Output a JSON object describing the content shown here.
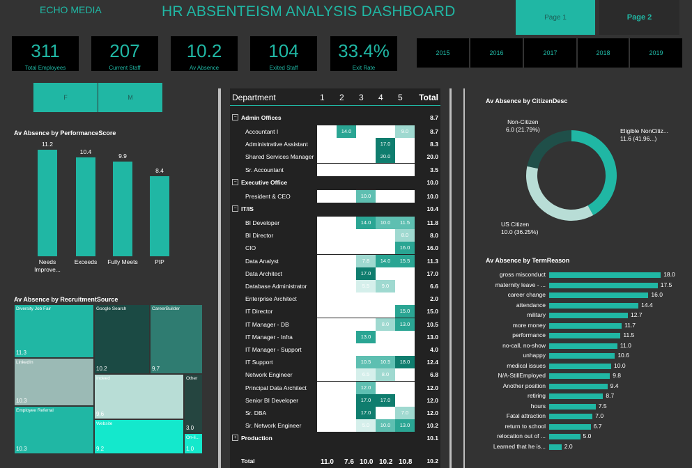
{
  "header": {
    "brand": "ECHO MEDIA",
    "title": "HR ABSENTEISM ANALYSIS DASHBOARD",
    "pages": [
      "Page 1",
      "Page 2"
    ]
  },
  "kpis": [
    {
      "value": "311",
      "label": "Total Employees"
    },
    {
      "value": "207",
      "label": "Current Staff"
    },
    {
      "value": "10.2",
      "label": "Av Absence"
    },
    {
      "value": "104",
      "label": "Exited Staff"
    },
    {
      "value": "33.4%",
      "label": "Exit Rate"
    }
  ],
  "years": [
    "2015",
    "2016",
    "2017",
    "2018",
    "2019"
  ],
  "genders": [
    "F",
    "M"
  ],
  "perf_chart": {
    "title": "Av Absence by PerformanceScore",
    "chart_data": {
      "type": "bar",
      "categories": [
        "Needs Improve...",
        "Exceeds",
        "Fully Meets",
        "PIP"
      ],
      "values": [
        11.2,
        10.4,
        9.9,
        8.4
      ]
    }
  },
  "recruit_chart": {
    "title": "Av Absence by RecruitmentSource",
    "chart_data": {
      "type": "treemap",
      "items": [
        {
          "label": "Diversity Job Fair",
          "value": 11.3
        },
        {
          "label": "LinkedIn",
          "value": 10.3
        },
        {
          "label": "Employee Referral",
          "value": 10.3
        },
        {
          "label": "Google Search",
          "value": 10.2
        },
        {
          "label": "CareerBuilder",
          "value": 9.7
        },
        {
          "label": "Indeed",
          "value": 9.6
        },
        {
          "label": "Website",
          "value": 9.2
        },
        {
          "label": "Other",
          "value": 3.0
        },
        {
          "label": "On-li...",
          "value": 1.0
        }
      ]
    }
  },
  "matrix": {
    "header": {
      "dept": "Department",
      "cols": [
        "1",
        "2",
        "3",
        "4",
        "5"
      ],
      "total": "Total"
    },
    "rows": [
      {
        "type": "group",
        "name": "Admin Offices",
        "total": "8.7",
        "sym": "⊟"
      },
      {
        "type": "item",
        "name": "Accountant I",
        "cells": [
          "",
          "14.0",
          "",
          "",
          "9.0"
        ],
        "total": "8.7"
      },
      {
        "type": "item",
        "name": "Administrative Assistant",
        "cells": [
          "",
          "",
          "",
          "17.0",
          ""
        ],
        "total": "8.3"
      },
      {
        "type": "item",
        "name": "Shared Services Manager",
        "cells": [
          "",
          "",
          "",
          "20.0",
          ""
        ],
        "total": "20.0"
      },
      {
        "type": "item",
        "name": "Sr. Accountant",
        "cells": [
          "",
          "",
          "",
          "",
          ""
        ],
        "total": "3.5"
      },
      {
        "type": "group",
        "name": "Executive Office",
        "total": "10.0",
        "sym": "⊟"
      },
      {
        "type": "item",
        "name": "President & CEO",
        "cells": [
          "",
          "",
          "10.0",
          "",
          ""
        ],
        "total": "10.0"
      },
      {
        "type": "group",
        "name": "IT/IS",
        "total": "10.4",
        "sym": "⊟"
      },
      {
        "type": "item",
        "name": "BI Developer",
        "cells": [
          "",
          "",
          "14.0",
          "10.0",
          "11.5"
        ],
        "total": "11.8"
      },
      {
        "type": "item",
        "name": "BI Director",
        "cells": [
          "",
          "",
          "",
          "",
          "8.0"
        ],
        "total": "8.0"
      },
      {
        "type": "item",
        "name": "CIO",
        "cells": [
          "",
          "",
          "",
          "",
          "16.0"
        ],
        "total": "16.0"
      },
      {
        "type": "item",
        "name": "Data Analyst",
        "cells": [
          "",
          "",
          "7.8",
          "14.0",
          "15.5"
        ],
        "total": "11.3"
      },
      {
        "type": "item",
        "name": "Data Architect",
        "cells": [
          "",
          "",
          "17.0",
          "",
          ""
        ],
        "total": "17.0"
      },
      {
        "type": "item",
        "name": "Database Administrator",
        "cells": [
          "",
          "",
          "5.5",
          "9.0",
          ""
        ],
        "total": "6.6"
      },
      {
        "type": "item",
        "name": "Enterprise Architect",
        "cells": [
          "",
          "",
          "",
          "",
          ""
        ],
        "total": "2.0"
      },
      {
        "type": "item",
        "name": "IT Director",
        "cells": [
          "",
          "",
          "",
          "",
          "15.0"
        ],
        "total": "15.0"
      },
      {
        "type": "item",
        "name": "IT Manager - DB",
        "cells": [
          "",
          "",
          "",
          "8.0",
          "13.0"
        ],
        "total": "10.5"
      },
      {
        "type": "item",
        "name": "IT Manager - Infra",
        "cells": [
          "",
          "",
          "13.0",
          "",
          ""
        ],
        "total": "13.0"
      },
      {
        "type": "item",
        "name": "IT Manager - Support",
        "cells": [
          "",
          "",
          "",
          "",
          ""
        ],
        "total": "4.0"
      },
      {
        "type": "item",
        "name": "IT Support",
        "cells": [
          "",
          "",
          "10.5",
          "10.5",
          "18.0"
        ],
        "total": "12.4"
      },
      {
        "type": "item",
        "name": "Network Engineer",
        "cells": [
          "",
          "",
          "6.5",
          "8.0",
          ""
        ],
        "total": "6.8"
      },
      {
        "type": "item",
        "name": "Principal Data Architect",
        "cells": [
          "",
          "",
          "12.0",
          "",
          ""
        ],
        "total": "12.0"
      },
      {
        "type": "item",
        "name": "Senior BI Developer",
        "cells": [
          "",
          "",
          "17.0",
          "17.0",
          ""
        ],
        "total": "12.0"
      },
      {
        "type": "item",
        "name": "Sr. DBA",
        "cells": [
          "",
          "",
          "17.0",
          "",
          "7.0"
        ],
        "total": "12.0"
      },
      {
        "type": "item",
        "name": "Sr. Network Engineer",
        "cells": [
          "",
          "",
          "5.0",
          "10.0",
          "13.0"
        ],
        "total": "10.2"
      },
      {
        "type": "group",
        "name": "Production",
        "total": "10.1",
        "sym": "⊞"
      }
    ],
    "footer": {
      "label": "Total",
      "cols": [
        "11.0",
        "7.6",
        "10.0",
        "10.2",
        "10.8"
      ],
      "total": "10.2"
    }
  },
  "citizen_chart": {
    "title": "Av Absence by CitizenDesc",
    "chart_data": {
      "type": "pie",
      "slices": [
        {
          "label": "Eligible NonCitiz...",
          "value": 11.6,
          "pct": "11.6 (41.96...)",
          "color": "#20b7a4"
        },
        {
          "label": "US Citizen",
          "value": 10.0,
          "pct": "10.0 (36.25%)",
          "color": "#b8ddd6"
        },
        {
          "label": "Non-Citizen",
          "value": 6.0,
          "pct": "6.0 (21.79%)",
          "color": "#1f4f49"
        }
      ]
    }
  },
  "term_chart": {
    "title": "Av Absence by TermReason",
    "chart_data": {
      "type": "bar",
      "categories": [
        "gross misconduct",
        "maternity leave - ...",
        "career change",
        "attendance",
        "military",
        "more money",
        "performance",
        "no-call, no-show",
        "unhappy",
        "medical issues",
        "N/A-StillEmployed",
        "Another position",
        "retiring",
        "hours",
        "Fatal attraction",
        "return to school",
        "relocation out of ...",
        "Learned that he is..."
      ],
      "values": [
        18.0,
        17.5,
        16.0,
        14.4,
        12.7,
        11.7,
        11.5,
        11.0,
        10.6,
        10.0,
        9.8,
        9.4,
        8.7,
        7.5,
        7.0,
        6.7,
        5.0,
        2.0
      ]
    }
  },
  "colors": {
    "accent": "#20b7a4",
    "background": "#333333"
  }
}
